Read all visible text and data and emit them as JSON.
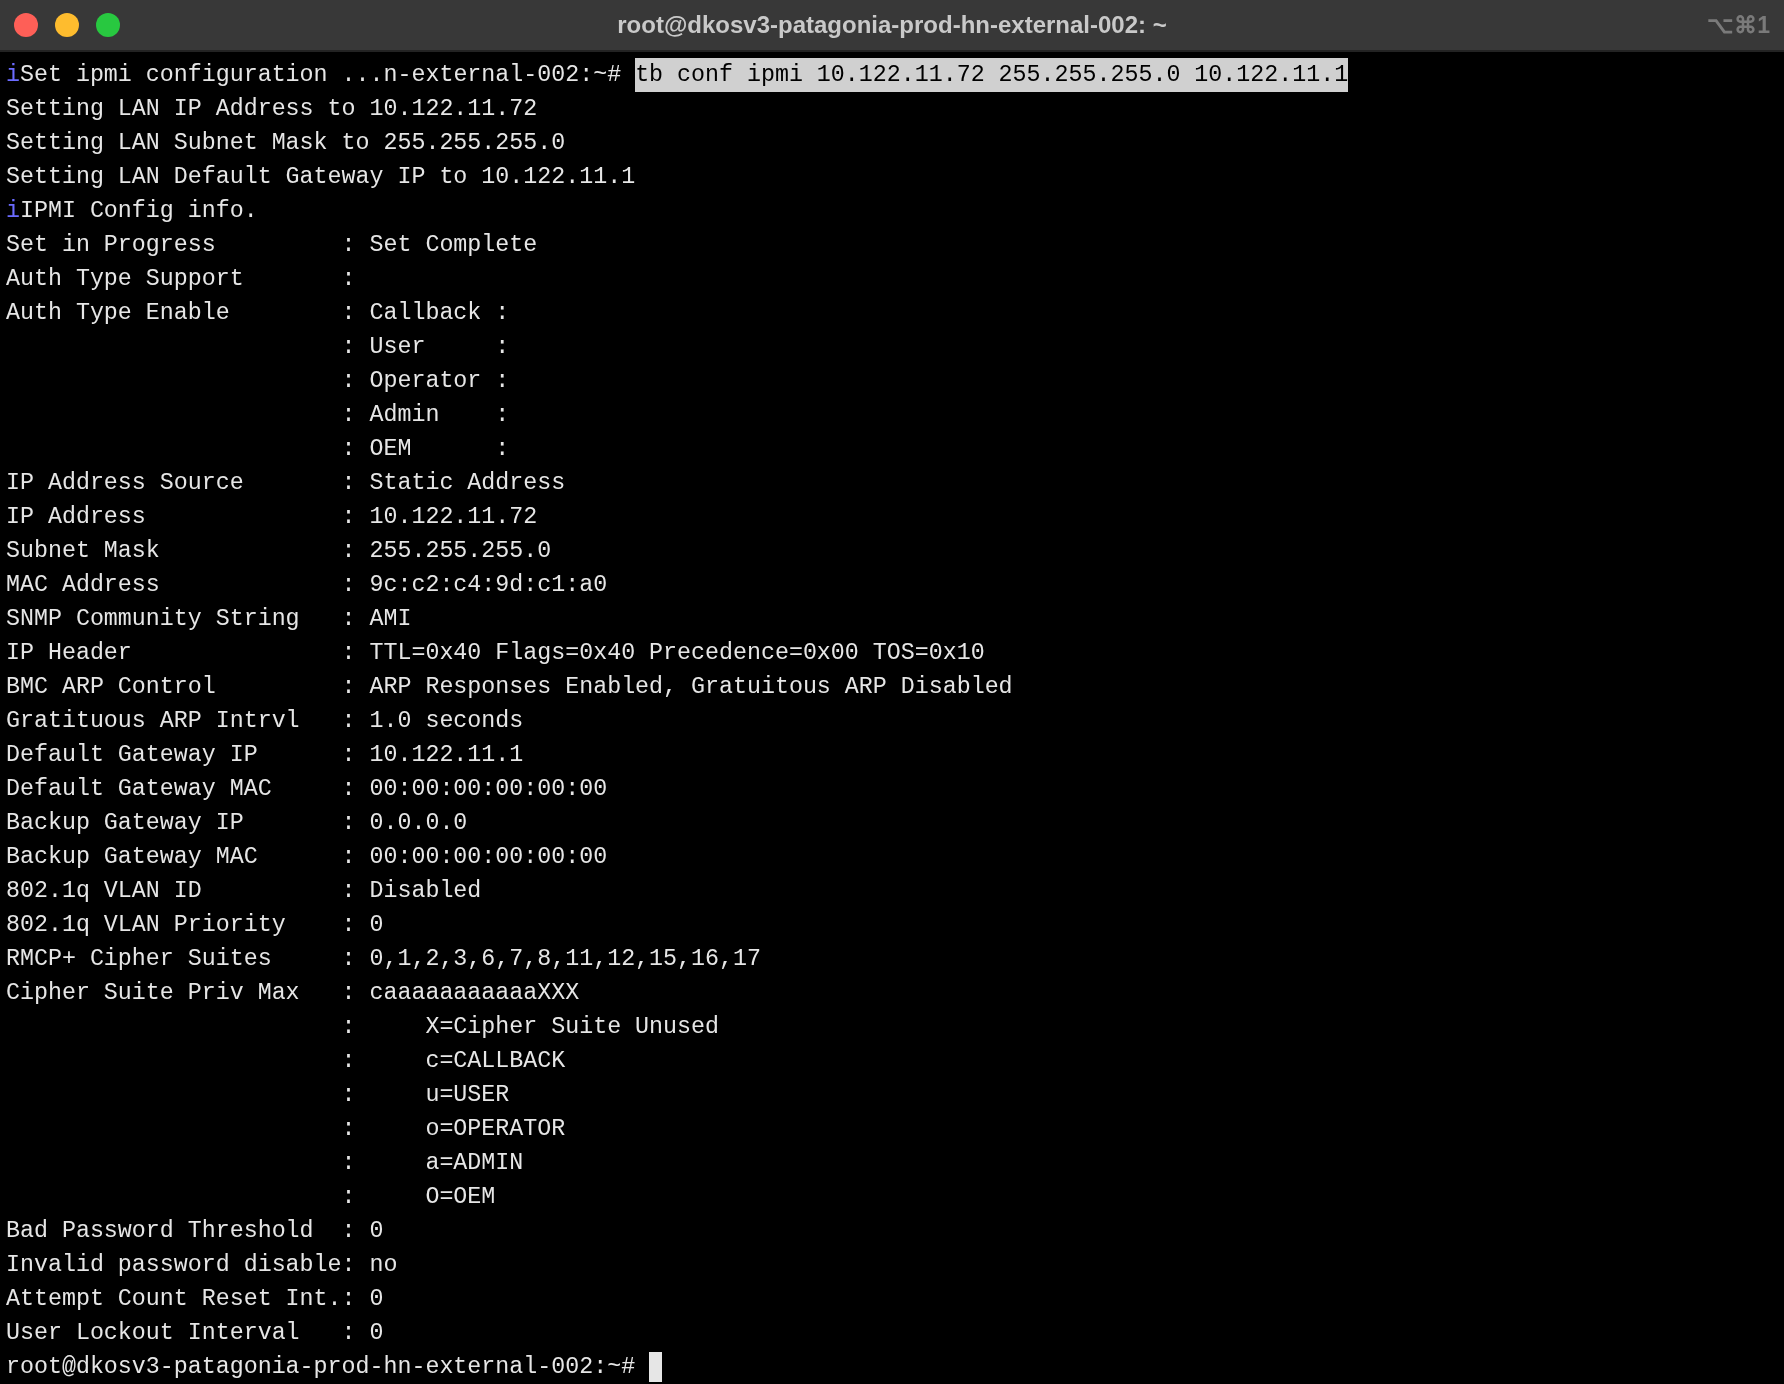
{
  "window": {
    "title": "root@dkosv3-patagonia-prod-hn-external-002: ~",
    "shortcut": "⌥⌘1"
  },
  "lines": [
    {
      "kind": "command",
      "marker": "i",
      "text": "Set ipmi configuration ...n-external-002:~# ",
      "command": "tb conf ipmi 10.122.11.72 255.255.255.0 10.122.11.1"
    },
    {
      "kind": "output",
      "text": "Setting LAN IP Address to 10.122.11.72"
    },
    {
      "kind": "output",
      "text": "Setting LAN Subnet Mask to 255.255.255.0"
    },
    {
      "kind": "output",
      "text": "Setting LAN Default Gateway IP to 10.122.11.1"
    },
    {
      "kind": "info",
      "marker": "i",
      "text": "IPMI Config info."
    },
    {
      "kind": "output",
      "text": "Set in Progress         : Set Complete"
    },
    {
      "kind": "output",
      "text": "Auth Type Support       :"
    },
    {
      "kind": "output",
      "text": "Auth Type Enable        : Callback :"
    },
    {
      "kind": "output",
      "text": "                        : User     :"
    },
    {
      "kind": "output",
      "text": "                        : Operator :"
    },
    {
      "kind": "output",
      "text": "                        : Admin    :"
    },
    {
      "kind": "output",
      "text": "                        : OEM      :"
    },
    {
      "kind": "output",
      "text": "IP Address Source       : Static Address"
    },
    {
      "kind": "output",
      "text": "IP Address              : 10.122.11.72"
    },
    {
      "kind": "output",
      "text": "Subnet Mask             : 255.255.255.0"
    },
    {
      "kind": "output",
      "text": "MAC Address             : 9c:c2:c4:9d:c1:a0"
    },
    {
      "kind": "output",
      "text": "SNMP Community String   : AMI"
    },
    {
      "kind": "output",
      "text": "IP Header               : TTL=0x40 Flags=0x40 Precedence=0x00 TOS=0x10"
    },
    {
      "kind": "output",
      "text": "BMC ARP Control         : ARP Responses Enabled, Gratuitous ARP Disabled"
    },
    {
      "kind": "output",
      "text": "Gratituous ARP Intrvl   : 1.0 seconds"
    },
    {
      "kind": "output",
      "text": "Default Gateway IP      : 10.122.11.1"
    },
    {
      "kind": "output",
      "text": "Default Gateway MAC     : 00:00:00:00:00:00"
    },
    {
      "kind": "output",
      "text": "Backup Gateway IP       : 0.0.0.0"
    },
    {
      "kind": "output",
      "text": "Backup Gateway MAC      : 00:00:00:00:00:00"
    },
    {
      "kind": "output",
      "text": "802.1q VLAN ID          : Disabled"
    },
    {
      "kind": "output",
      "text": "802.1q VLAN Priority    : 0"
    },
    {
      "kind": "output",
      "text": "RMCP+ Cipher Suites     : 0,1,2,3,6,7,8,11,12,15,16,17"
    },
    {
      "kind": "output",
      "text": "Cipher Suite Priv Max   : caaaaaaaaaaaXXX"
    },
    {
      "kind": "output",
      "text": "                        :     X=Cipher Suite Unused"
    },
    {
      "kind": "output",
      "text": "                        :     c=CALLBACK"
    },
    {
      "kind": "output",
      "text": "                        :     u=USER"
    },
    {
      "kind": "output",
      "text": "                        :     o=OPERATOR"
    },
    {
      "kind": "output",
      "text": "                        :     a=ADMIN"
    },
    {
      "kind": "output",
      "text": "                        :     O=OEM"
    },
    {
      "kind": "output",
      "text": "Bad Password Threshold  : 0"
    },
    {
      "kind": "output",
      "text": "Invalid password disable: no"
    },
    {
      "kind": "output",
      "text": "Attempt Count Reset Int.: 0"
    },
    {
      "kind": "output",
      "text": "User Lockout Interval   : 0"
    },
    {
      "kind": "prompt",
      "text": "root@dkosv3-patagonia-prod-hn-external-002:~# "
    }
  ]
}
